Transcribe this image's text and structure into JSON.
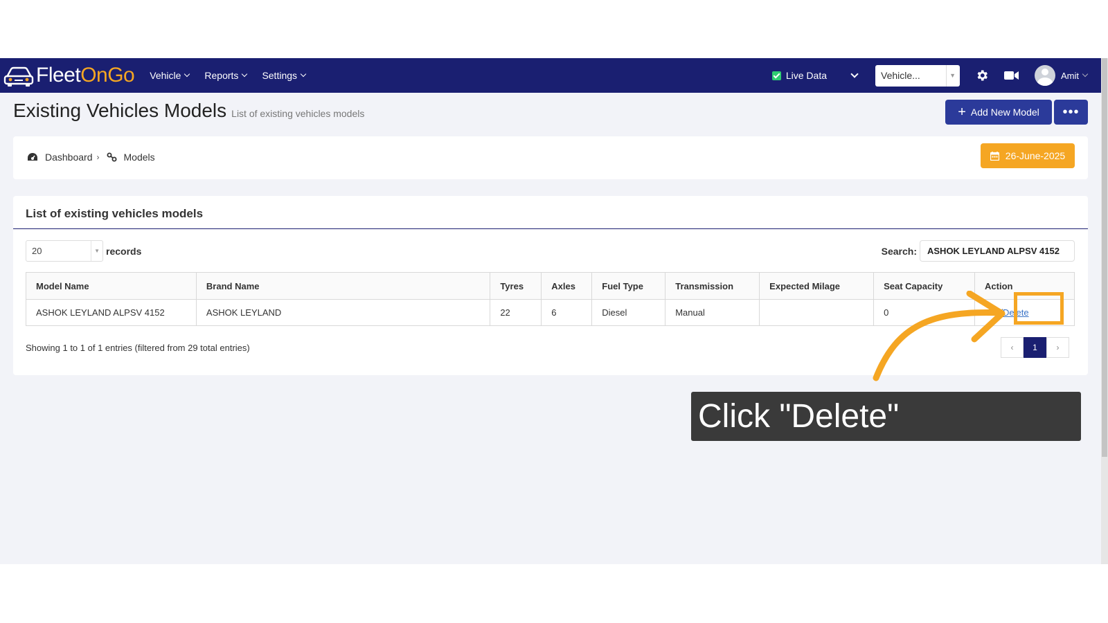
{
  "app": {
    "logo_part1": "Fleet",
    "logo_part2": "OnGo",
    "brand_colors": {
      "navbar": "#1a1f71",
      "accent": "#f5a623",
      "button": "#2b3a9a",
      "link": "#3a73c6"
    }
  },
  "nav": {
    "items": [
      {
        "label": "Vehicle"
      },
      {
        "label": "Reports"
      },
      {
        "label": "Settings"
      }
    ],
    "live_data_label": "Live Data",
    "vehicle_select": "Vehicle...",
    "user_name": "Amit",
    "icons": [
      "car-icon",
      "gear-icon",
      "camera-icon",
      "avatar-icon"
    ]
  },
  "page": {
    "title": "Existing Vehicles Models",
    "subtitle": "List of existing vehicles models",
    "add_button": "Add New Model",
    "more_button": "•••"
  },
  "breadcrumb": {
    "items": [
      "Dashboard",
      "Models"
    ],
    "separator": "›",
    "date": "26-June-2025"
  },
  "card": {
    "title": "List of existing vehicles models",
    "length_value": "20",
    "length_suffix": "records",
    "search_label": "Search:",
    "search_value": "ASHOK LEYLAND ALPSV 4152",
    "columns": [
      "Model Name",
      "Brand Name",
      "Tyres",
      "Axles",
      "Fuel Type",
      "Transmission",
      "Expected Milage",
      "Seat Capacity",
      "Action"
    ],
    "rows": [
      {
        "model_name": "ASHOK LEYLAND ALPSV 4152",
        "brand_name": "ASHOK LEYLAND",
        "tyres": "22",
        "axles": "6",
        "fuel_type": "Diesel",
        "transmission": "Manual",
        "expected_milage": "",
        "seat_capacity": "0",
        "action_edit": "Edit",
        "action_sep": "/",
        "action_delete": "Delete"
      }
    ],
    "info": "Showing 1 to 1 of 1 entries (filtered from 29 total entries)",
    "pager": {
      "prev": "‹",
      "current": "1",
      "next": "›"
    }
  },
  "annotation": {
    "callout": "Click \"Delete\""
  }
}
